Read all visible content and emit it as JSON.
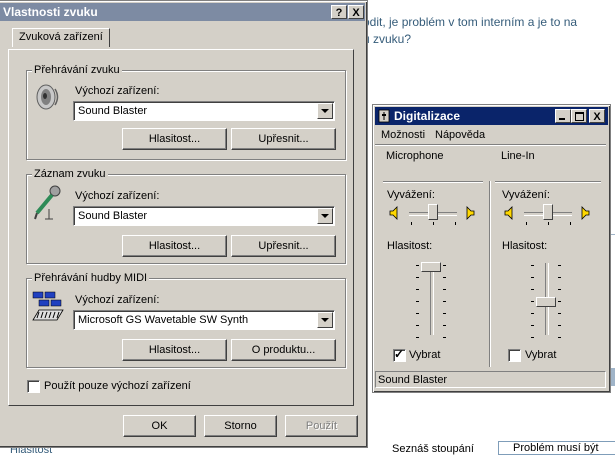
{
  "background": {
    "line1": "odit, je problém v tom interním a je to na",
    "line2": "u zvuku?",
    "bottom_left": "Hlasitost",
    "bottom_right": "Seznáš stoupání",
    "bottom_field": "Problém musí být"
  },
  "sound_props": {
    "title": "Vlastnosti zvuku",
    "help_button": "?",
    "close_button": "X",
    "tab": "Zvuková zařízení",
    "playback": {
      "group_label": "Přehrávání zvuku",
      "device_label": "Výchozí zařízení:",
      "device_value": "Sound Blaster",
      "volume_button": "Hlasitost...",
      "advanced_button": "Upřesnit..."
    },
    "recording": {
      "group_label": "Záznam zvuku",
      "device_label": "Výchozí zařízení:",
      "device_value": "Sound Blaster",
      "volume_button": "Hlasitost...",
      "advanced_button": "Upřesnit..."
    },
    "midi": {
      "group_label": "Přehrávání hudby MIDI",
      "device_label": "Výchozí zařízení:",
      "device_value": "Microsoft GS Wavetable SW Synth",
      "volume_button": "Hlasitost...",
      "about_button": "O produktu..."
    },
    "default_only_label": "Použít pouze výchozí zařízení",
    "default_only_checked": false,
    "ok_button": "OK",
    "cancel_button": "Storno",
    "apply_button": "Použít"
  },
  "digitalizace": {
    "title": "Digitalizace",
    "menu": [
      "Možnosti",
      "Nápověda"
    ],
    "channels": [
      {
        "name": "Microphone",
        "balance_label": "Vyvážení:",
        "volume_label": "Hlasitost:",
        "select_label": "Vybrat",
        "selected": true,
        "balance": 0.5,
        "volume": 0.95
      },
      {
        "name": "Line-In",
        "balance_label": "Vyvážení:",
        "volume_label": "Hlasitost:",
        "select_label": "Vybrat",
        "selected": false,
        "balance": 0.5,
        "volume": 0.5
      }
    ],
    "status": "Sound Blaster"
  },
  "colors": {
    "title_active": "#0a246a",
    "title_inactive": "#7d8ba3",
    "face": "#d4d0c8"
  }
}
